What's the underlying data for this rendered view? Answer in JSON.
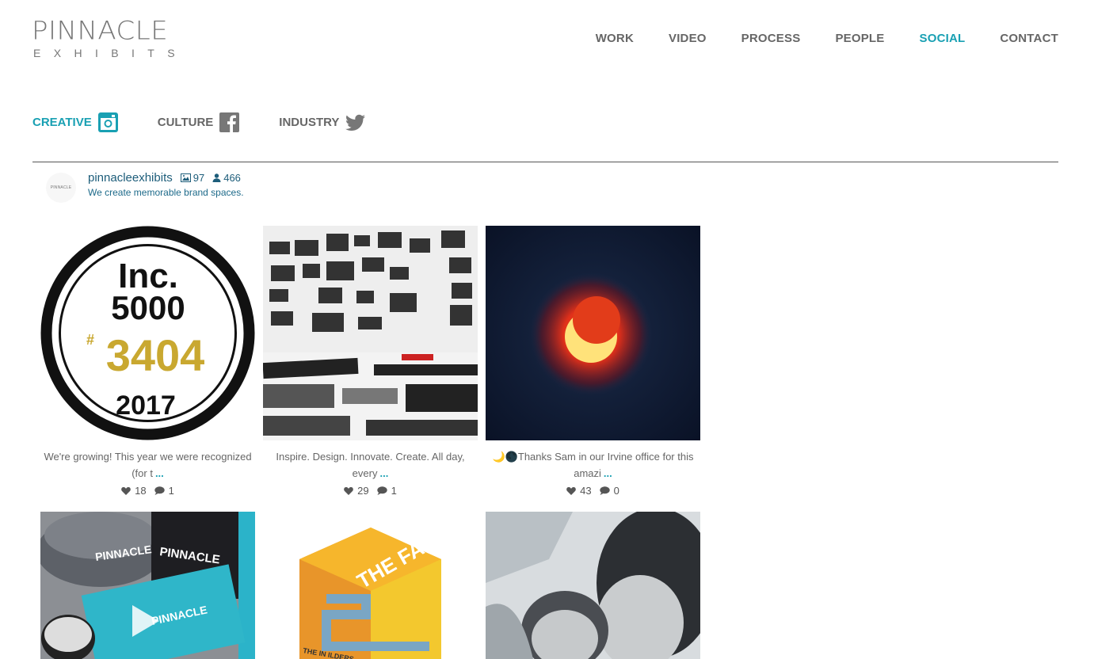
{
  "brand": {
    "name": "PINNACLE",
    "sub": "EXHIBITS"
  },
  "nav": [
    "WORK",
    "VIDEO",
    "PROCESS",
    "PEOPLE",
    "SOCIAL",
    "CONTACT"
  ],
  "nav_active": "SOCIAL",
  "tabs": [
    {
      "label": "CREATIVE",
      "icon": "instagram-icon"
    },
    {
      "label": "CULTURE",
      "icon": "facebook-icon"
    },
    {
      "label": "INDUSTRY",
      "icon": "twitter-icon"
    }
  ],
  "profile": {
    "avatar_text": "PINNACLE",
    "username": "pinnacleexhibits",
    "posts": "97",
    "followers": "466",
    "bio": "We create memorable brand spaces."
  },
  "posts": [
    {
      "caption": "We're growing! This year we were recognized (for t",
      "more": "...",
      "likes": "18",
      "comments": "1",
      "image": "inc-5000-badge",
      "badge_top": "Inc.",
      "badge_num": "5000",
      "badge_rank": "3404",
      "badge_year": "2017"
    },
    {
      "caption": "Inspire. Design. Innovate. Create. All day, every",
      "more": "...",
      "likes": "29",
      "comments": "1",
      "image": "design-board-photo"
    },
    {
      "caption": "🌙🌑Thanks Sam in our Irvine office for this amazi",
      "more": "...",
      "likes": "43",
      "comments": "0",
      "image": "solar-eclipse-photo"
    },
    {
      "caption": "",
      "more": "",
      "likes": "",
      "comments": "",
      "image": "branded-merch-video",
      "hat1": "PINNACLE",
      "hat2": "PINNACLE",
      "card_text": "PINNACLE"
    },
    {
      "caption": "",
      "more": "",
      "likes": "",
      "comments": "",
      "image": "the-fab-logo",
      "fab_text": "THE FAB",
      "fab_sub": "THE IN          ILDERS"
    },
    {
      "caption": "",
      "more": "",
      "likes": "",
      "comments": "",
      "image": "couple-photo"
    }
  ],
  "colors": {
    "accent": "#19a0b3",
    "nav": "#666666",
    "profile": "#1d5d7a"
  }
}
